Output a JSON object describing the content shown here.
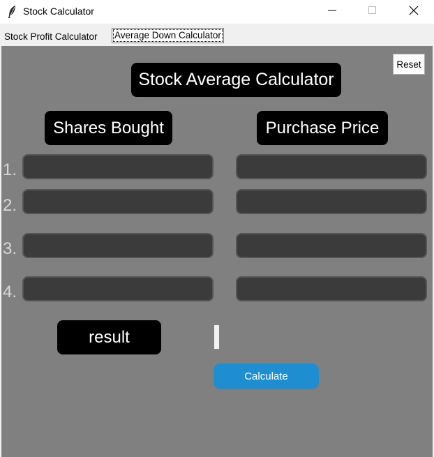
{
  "window": {
    "title": "Stock Calculator",
    "icons": {
      "app": "feather-icon",
      "minimize": "minimize-icon",
      "maximize": "maximize-icon",
      "close": "close-icon"
    }
  },
  "tabs": [
    {
      "label": "Stock Profit Calculator",
      "selected": false
    },
    {
      "label": "Average Down Calculator",
      "selected": true
    }
  ],
  "toolbar": {
    "reset_label": "Reset"
  },
  "main": {
    "title": "Stock Average Calculator",
    "shares_header": "Shares Bought",
    "price_header": "Purchase Price",
    "rows": [
      {
        "number": "1.",
        "shares_value": "",
        "price_value": ""
      },
      {
        "number": "2.",
        "shares_value": "",
        "price_value": ""
      },
      {
        "number": "3.",
        "shares_value": "",
        "price_value": ""
      },
      {
        "number": "4.",
        "shares_value": "",
        "price_value": ""
      }
    ],
    "result_label": "result",
    "result_value": "",
    "calculate_label": "Calculate"
  },
  "colors": {
    "canvas": "#808080",
    "pill": "#000000",
    "field": "#3b3b3b",
    "accent": "#1f8ed0"
  }
}
